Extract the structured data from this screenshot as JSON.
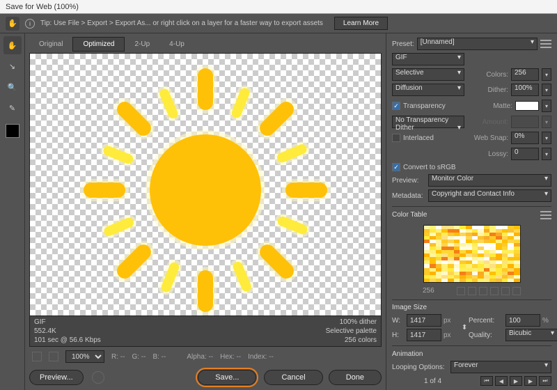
{
  "title": "Save for Web (100%)",
  "tip": {
    "text": "Tip: Use File > Export > Export As...   or right click on a layer for a faster way to export assets",
    "learn": "Learn More"
  },
  "tabs": [
    "Original",
    "Optimized",
    "2-Up",
    "4-Up"
  ],
  "activeTab": 1,
  "previewMeta": {
    "left": [
      "GIF",
      "552.4K",
      "101 sec @ 56.6 Kbps"
    ],
    "right": [
      "100% dither",
      "Selective palette",
      "256 colors"
    ]
  },
  "status": {
    "zoom": "100%",
    "r": "R: --",
    "g": "G: --",
    "b": "B: --",
    "alpha": "Alpha: --",
    "hex": "Hex: --",
    "index": "Index: --"
  },
  "preset": {
    "label": "Preset:",
    "value": "[Unnamed]"
  },
  "format": "GIF",
  "reduction": "Selective",
  "dither_method": "Diffusion",
  "transparency": {
    "label": "Transparency",
    "checked": true
  },
  "trans_dither": "No Transparency Dither",
  "interlaced": {
    "label": "Interlaced",
    "checked": false
  },
  "colors": {
    "label": "Colors:",
    "value": "256"
  },
  "dither": {
    "label": "Dither:",
    "value": "100%"
  },
  "matte": {
    "label": "Matte:"
  },
  "amount": {
    "label": "Amount:",
    "value": ""
  },
  "websnap": {
    "label": "Web Snap:",
    "value": "0%"
  },
  "lossy": {
    "label": "Lossy:",
    "value": "0"
  },
  "srgb": {
    "label": "Convert to sRGB",
    "checked": true
  },
  "preview": {
    "label": "Preview:",
    "value": "Monitor Color"
  },
  "metadata": {
    "label": "Metadata:",
    "value": "Copyright and Contact Info"
  },
  "colortable": {
    "label": "Color Table",
    "count": "256"
  },
  "imagesize": {
    "label": "Image Size",
    "w_label": "W:",
    "w": "1417",
    "h_label": "H:",
    "h": "1417",
    "unit": "px",
    "percent_label": "Percent:",
    "percent": "100",
    "percent_unit": "%",
    "quality_label": "Quality:",
    "quality": "Bicubic"
  },
  "animation": {
    "label": "Animation",
    "loop_label": "Looping Options:",
    "loop": "Forever",
    "frame": "1 of 4"
  },
  "footer": {
    "preview": "Preview...",
    "save": "Save...",
    "cancel": "Cancel",
    "done": "Done"
  }
}
